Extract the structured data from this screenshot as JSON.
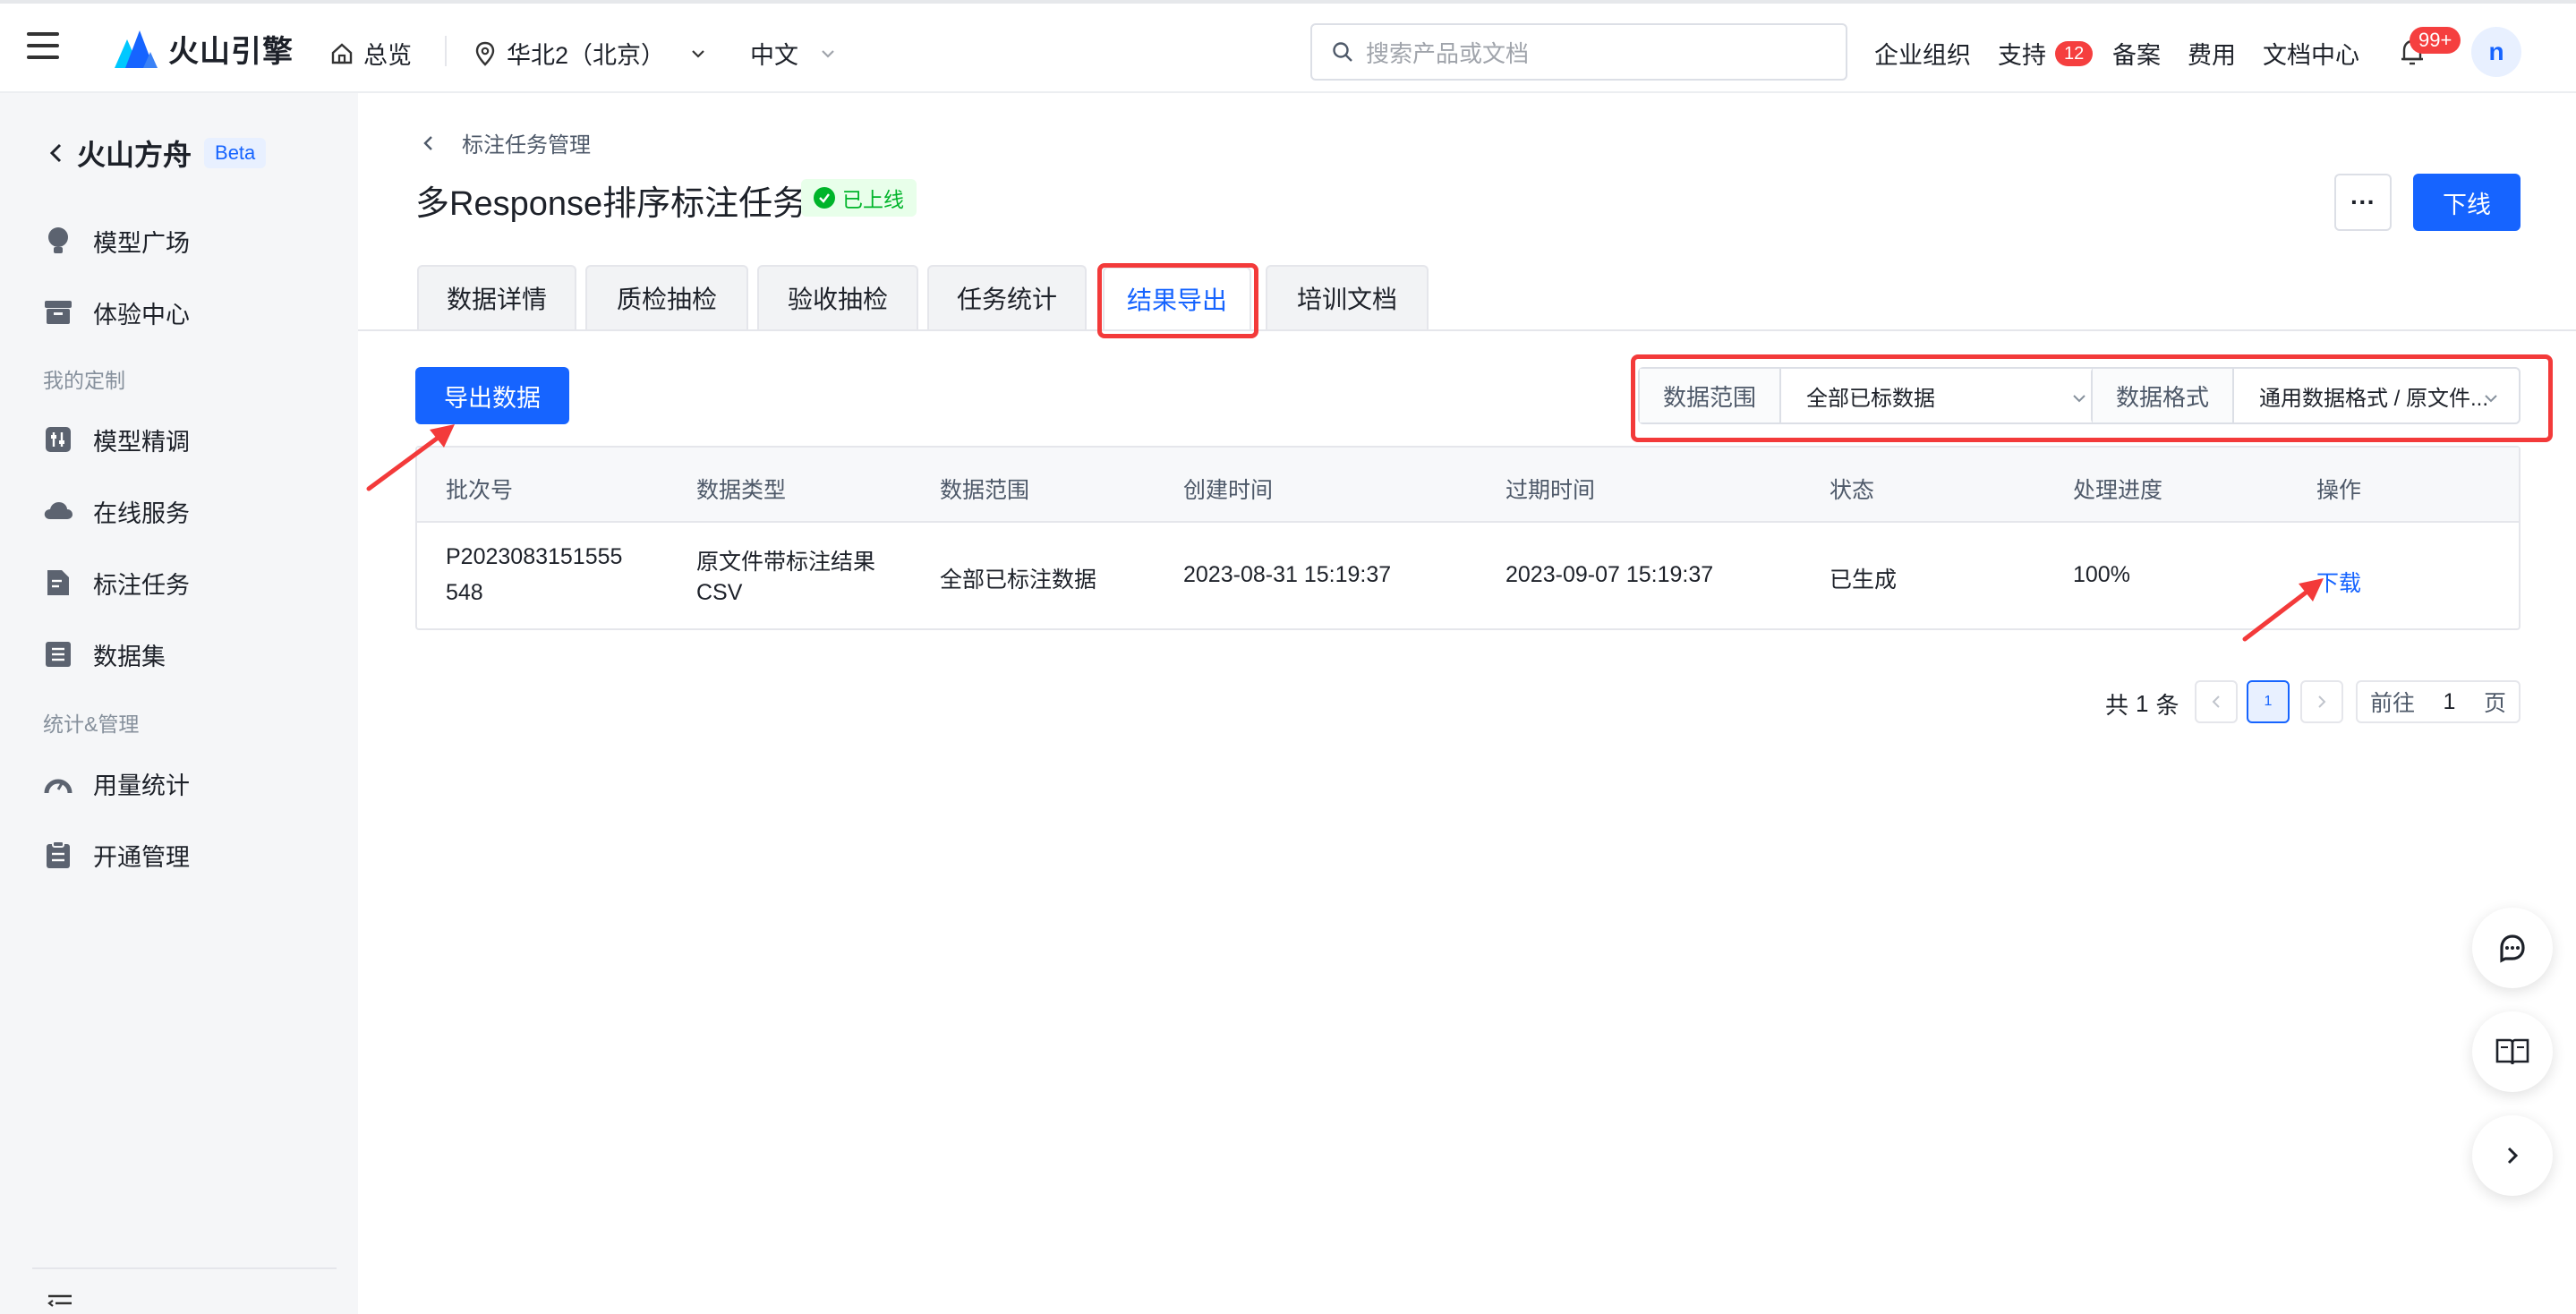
{
  "topbar": {
    "logo": "火山引擎",
    "overview": "总览",
    "region": "华北2（北京）",
    "language": "中文",
    "search_placeholder": "搜索产品或文档",
    "enterprise": "企业组织",
    "support": "支持",
    "support_badge": "12",
    "filing": "备案",
    "billing": "费用",
    "docs": "文档中心",
    "bell_badge": "99+",
    "avatar": "n"
  },
  "sidebar": {
    "title": "火山方舟",
    "beta": "Beta",
    "items": [
      {
        "label": "模型广场",
        "icon": "lightbulb-icon"
      },
      {
        "label": "体验中心",
        "icon": "box-icon"
      },
      {
        "label": "模型精调",
        "icon": "tune-icon"
      },
      {
        "label": "在线服务",
        "icon": "cloud-icon"
      },
      {
        "label": "标注任务",
        "icon": "document-edit-icon"
      },
      {
        "label": "数据集",
        "icon": "dataset-icon"
      },
      {
        "label": "用量统计",
        "icon": "gauge-icon"
      },
      {
        "label": "开通管理",
        "icon": "clipboard-icon"
      }
    ],
    "groups": [
      "我的定制",
      "统计&管理"
    ]
  },
  "page": {
    "breadcrumb": "标注任务管理",
    "title": "多Response排序标注任务",
    "status": "已上线",
    "more": "···",
    "offline_button": "下线"
  },
  "tabs": [
    "数据详情",
    "质检抽检",
    "验收抽检",
    "任务统计",
    "结果导出",
    "培训文档"
  ],
  "active_tab": "结果导出",
  "toolbar": {
    "export_button": "导出数据",
    "range_label": "数据范围",
    "range_value": "全部已标数据",
    "format_label": "数据格式",
    "format_value": "通用数据格式 / 原文件..."
  },
  "table": {
    "headers": [
      "批次号",
      "数据类型",
      "数据范围",
      "创建时间",
      "过期时间",
      "状态",
      "处理进度",
      "操作"
    ],
    "rows": [
      {
        "batch_line1": "P2023083151555",
        "batch_line2": "548",
        "type_line1": "原文件带标注结果",
        "type_line2": "CSV",
        "range": "全部已标注数据",
        "created": "2023-08-31 15:19:37",
        "expires": "2023-09-07 15:19:37",
        "status": "已生成",
        "progress": "100%",
        "action": "下载"
      }
    ]
  },
  "pagination": {
    "total_prefix": "共",
    "total": "1",
    "total_suffix": "条",
    "current_page": "1",
    "goto_prefix": "前往",
    "goto_value": "1",
    "goto_suffix": "页"
  },
  "colors": {
    "primary": "#1664ff",
    "highlight": "#f33a3a",
    "success": "#00b42a"
  }
}
